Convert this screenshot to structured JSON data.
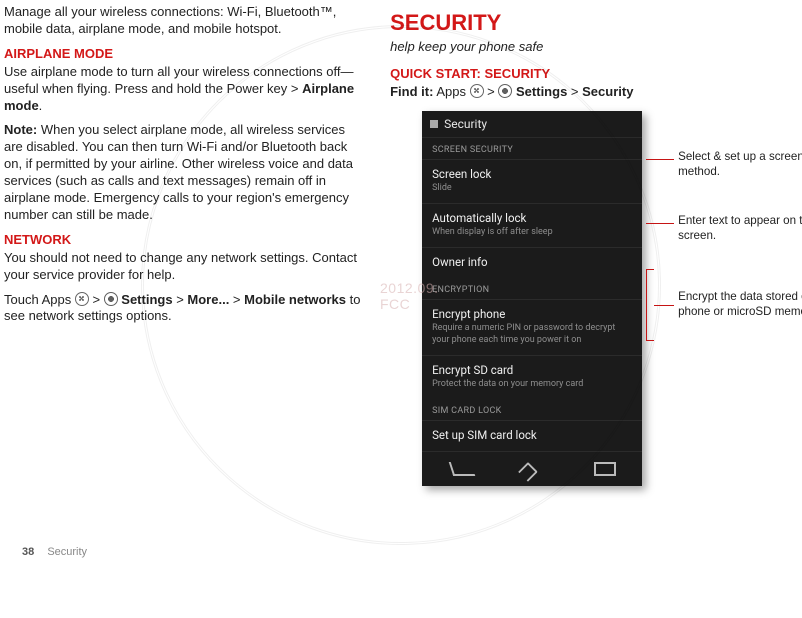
{
  "left": {
    "intro": "Manage all your wireless connections: Wi-Fi, Bluetooth™, mobile data, airplane mode, and mobile hotspot.",
    "airplane_heading": "AIRPLANE MODE",
    "airplane_body": "Use airplane mode to turn all your wireless connections off—useful when flying. Press and hold the Power key > ",
    "airplane_mode_label": "Airplane mode",
    "note_prefix": "Note: ",
    "note_body": "When you select airplane mode, all wireless services are disabled. You can then turn Wi-Fi and/or Bluetooth back on, if permitted by your airline. Other wireless voice and data services (such as calls and text messages) remain off in airplane mode. Emergency calls to your region's emergency number can still be made.",
    "network_heading": "NETWORK",
    "network_body1": "You should not need to change any network settings. Contact your service provider for help.",
    "network_body2_pre": "Touch Apps ",
    "settings": "Settings",
    "more": "More...",
    "mobile_networks": "Mobile networks",
    "network_body2_post": " to see network settings options."
  },
  "right": {
    "heading": "SECURITY",
    "subtitle": "help keep your phone safe",
    "quick": "QUICK START: SECURITY",
    "findit_label": "Find it:",
    "findit_apps": " Apps ",
    "findit_settings": "Settings",
    "findit_security": "Security"
  },
  "phone": {
    "title": "Security",
    "sec1": "SCREEN SECURITY",
    "r1t": "Screen lock",
    "r1s": "Slide",
    "r2t": "Automatically lock",
    "r2s": "When display is off after sleep",
    "r3t": "Owner info",
    "sec2": "ENCRYPTION",
    "r4t": "Encrypt phone",
    "r4s": "Require a numeric PIN or password to decrypt your phone each time you power it on",
    "r5t": "Encrypt SD card",
    "r5s": "Protect the data on your memory card",
    "sec3": "SIM CARD LOCK",
    "r6t": "Set up SIM card lock"
  },
  "annot": {
    "a1": "Select & set up a screen lock method.",
    "a2": "Enter text to appear on the lock screen.",
    "a3": "Encrypt the data stored on your phone or microSD memory card."
  },
  "footer": {
    "page": "38",
    "section": "Security"
  },
  "wm": {
    "text": "",
    "date": "2012.09.",
    "fcc": "FCC"
  }
}
